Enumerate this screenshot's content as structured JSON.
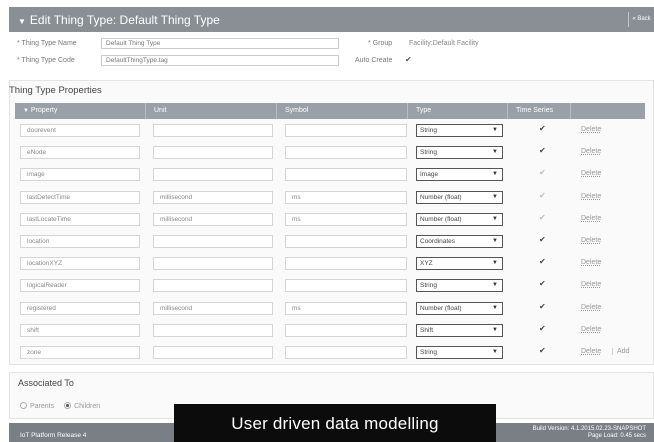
{
  "header": {
    "title": "Edit Thing Type: Default Thing Type",
    "back_label": "« Back"
  },
  "form": {
    "name_label": "* Thing Type Name",
    "name_value": "Default Thing Type",
    "code_label": "* Thing Type Code",
    "code_value": "DefaultThingType.tag",
    "group_label": "* Group",
    "group_value": "Facility:Default Facility",
    "autocreate_label": "Auto Create",
    "autocreate_checked": true
  },
  "properties": {
    "title": "Thing Type Properties",
    "columns": [
      "Property",
      "Unit",
      "Symbol",
      "Type",
      "Time Series"
    ],
    "delete_label": "Delete",
    "add_label": "Add",
    "rows": [
      {
        "name": "doorevent",
        "unit": "",
        "symbol": "",
        "type": "String",
        "timeseries": true
      },
      {
        "name": "eNode",
        "unit": "",
        "symbol": "",
        "type": "String",
        "timeseries": true
      },
      {
        "name": "image",
        "unit": "",
        "symbol": "",
        "type": "Image",
        "timeseries": false
      },
      {
        "name": "lastDetectTime",
        "unit": "millisecond",
        "symbol": "ms",
        "type": "Number (float)",
        "timeseries": false
      },
      {
        "name": "lastLocateTime",
        "unit": "millisecond",
        "symbol": "ms",
        "type": "Number (float)",
        "timeseries": false
      },
      {
        "name": "location",
        "unit": "",
        "symbol": "",
        "type": "Coordinates",
        "timeseries": true
      },
      {
        "name": "locationXYZ",
        "unit": "",
        "symbol": "",
        "type": "XYZ",
        "timeseries": true
      },
      {
        "name": "logicalReader",
        "unit": "",
        "symbol": "",
        "type": "String",
        "timeseries": true
      },
      {
        "name": "registered",
        "unit": "millisecond",
        "symbol": "ms",
        "type": "Number (float)",
        "timeseries": true
      },
      {
        "name": "shift",
        "unit": "",
        "symbol": "",
        "type": "Shift",
        "timeseries": true
      },
      {
        "name": "zone",
        "unit": "",
        "symbol": "",
        "type": "String",
        "timeseries": true
      }
    ]
  },
  "associated": {
    "title": "Associated To",
    "parents_label": "Parents",
    "children_label": "Children",
    "selected": "children"
  },
  "footer": {
    "release": "IoT Platform Release 4",
    "build": "Build Version: 4.1.2015.02.23-SNAPSHOT",
    "page_load": "Page Load: 0.45 secs"
  },
  "caption": "User driven data modelling",
  "icons": {
    "caret": "▼",
    "check": "✔",
    "dropdown": "▼"
  }
}
